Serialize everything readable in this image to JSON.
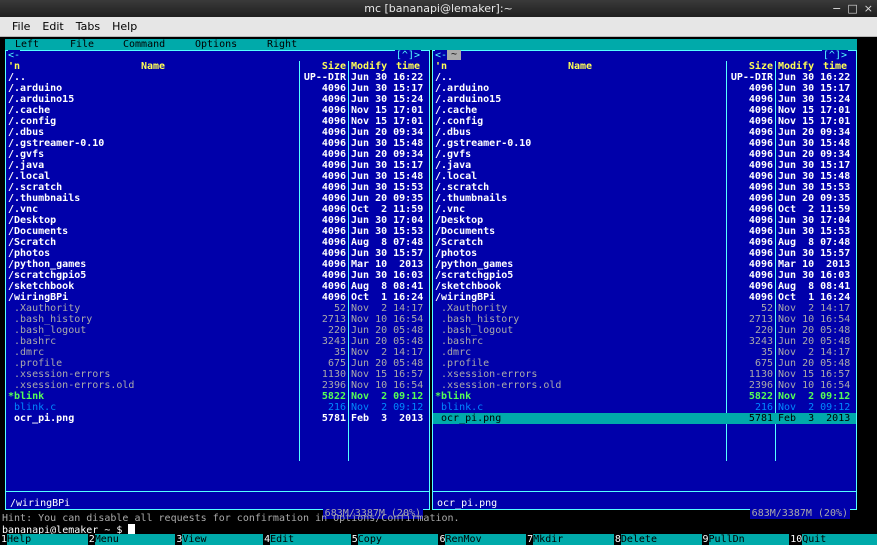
{
  "window": {
    "title": "mc [bananapi@lemaker]:~",
    "controls": [
      "−",
      "□",
      "×"
    ]
  },
  "menubar": [
    "File",
    "Edit",
    "Tabs",
    "Help"
  ],
  "mc_menu": [
    "Left",
    "File",
    "Command",
    "Options",
    "Right"
  ],
  "panels": {
    "header": {
      "sort": "'n",
      "name": "Name",
      "size": "Size",
      "modify": "Modify",
      "time": "time"
    },
    "left_corner": "<-",
    "left_indicator": "[^]>",
    "right_indicator": "[^]>",
    "right_tilde": "~",
    "left": {
      "mini_status": "/wiringBPi",
      "free_space": "683M/3387M (20%)",
      "files": [
        {
          "name": "/..",
          "size": "UP--DIR",
          "modify": "Jun 30 16:22",
          "type": "dir"
        },
        {
          "name": "/.arduino",
          "size": "4096",
          "modify": "Jun 30 15:17",
          "type": "dir"
        },
        {
          "name": "/.arduino15",
          "size": "4096",
          "modify": "Jun 30 15:24",
          "type": "dir"
        },
        {
          "name": "/.cache",
          "size": "4096",
          "modify": "Nov 15 17:01",
          "type": "dir"
        },
        {
          "name": "/.config",
          "size": "4096",
          "modify": "Nov 15 17:01",
          "type": "dir"
        },
        {
          "name": "/.dbus",
          "size": "4096",
          "modify": "Jun 20 09:34",
          "type": "dir"
        },
        {
          "name": "/.gstreamer-0.10",
          "size": "4096",
          "modify": "Jun 30 15:48",
          "type": "dir"
        },
        {
          "name": "/.gvfs",
          "size": "4096",
          "modify": "Jun 20 09:34",
          "type": "dir"
        },
        {
          "name": "/.java",
          "size": "4096",
          "modify": "Jun 30 15:17",
          "type": "dir"
        },
        {
          "name": "/.local",
          "size": "4096",
          "modify": "Jun 30 15:48",
          "type": "dir"
        },
        {
          "name": "/.scratch",
          "size": "4096",
          "modify": "Jun 30 15:53",
          "type": "dir"
        },
        {
          "name": "/.thumbnails",
          "size": "4096",
          "modify": "Jun 20 09:35",
          "type": "dir"
        },
        {
          "name": "/.vnc",
          "size": "4096",
          "modify": "Oct  2 11:59",
          "type": "dir"
        },
        {
          "name": "/Desktop",
          "size": "4096",
          "modify": "Jun 30 17:04",
          "type": "dir"
        },
        {
          "name": "/Documents",
          "size": "4096",
          "modify": "Jun 30 15:53",
          "type": "dir"
        },
        {
          "name": "/Scratch",
          "size": "4096",
          "modify": "Aug  8 07:48",
          "type": "dir"
        },
        {
          "name": "/photos",
          "size": "4096",
          "modify": "Jun 30 15:57",
          "type": "dir"
        },
        {
          "name": "/python_games",
          "size": "4096",
          "modify": "Mar 10  2013",
          "type": "dir"
        },
        {
          "name": "/scratchgpio5",
          "size": "4096",
          "modify": "Jun 30 16:03",
          "type": "dir"
        },
        {
          "name": "/sketchbook",
          "size": "4096",
          "modify": "Aug  8 08:41",
          "type": "dir"
        },
        {
          "name": "/wiringBPi",
          "size": "4096",
          "modify": "Oct  1 16:24",
          "type": "dir"
        },
        {
          "name": " .Xauthority",
          "size": "52",
          "modify": "Nov  2 14:17",
          "type": "file"
        },
        {
          "name": " .bash_history",
          "size": "2713",
          "modify": "Nov 10 16:54",
          "type": "file"
        },
        {
          "name": " .bash_logout",
          "size": "220",
          "modify": "Jun 20 05:48",
          "type": "file"
        },
        {
          "name": " .bashrc",
          "size": "3243",
          "modify": "Jun 20 05:48",
          "type": "file"
        },
        {
          "name": " .dmrc",
          "size": "35",
          "modify": "Nov  2 14:17",
          "type": "file"
        },
        {
          "name": " .profile",
          "size": "675",
          "modify": "Jun 20 05:48",
          "type": "file"
        },
        {
          "name": " .xsession-errors",
          "size": "1130",
          "modify": "Nov 15 16:57",
          "type": "file"
        },
        {
          "name": " .xsession-errors.old",
          "size": "2396",
          "modify": "Nov 10 16:54",
          "type": "file"
        },
        {
          "name": "*blink",
          "size": "5822",
          "modify": "Nov  2 09:12",
          "type": "exec"
        },
        {
          "name": " blink.c",
          "size": "216",
          "modify": "Nov  2 09:12",
          "type": "csrc"
        },
        {
          "name": " ocr_pi.png",
          "size": "5781",
          "modify": "Feb  3  2013",
          "type": "img"
        }
      ]
    },
    "right": {
      "mini_status": "ocr_pi.png",
      "free_space": "683M/3387M (20%)",
      "selected_index": 31,
      "files": [
        {
          "name": "/..",
          "size": "UP--DIR",
          "modify": "Jun 30 16:22",
          "type": "dir"
        },
        {
          "name": "/.arduino",
          "size": "4096",
          "modify": "Jun 30 15:17",
          "type": "dir"
        },
        {
          "name": "/.arduino15",
          "size": "4096",
          "modify": "Jun 30 15:24",
          "type": "dir"
        },
        {
          "name": "/.cache",
          "size": "4096",
          "modify": "Nov 15 17:01",
          "type": "dir"
        },
        {
          "name": "/.config",
          "size": "4096",
          "modify": "Nov 15 17:01",
          "type": "dir"
        },
        {
          "name": "/.dbus",
          "size": "4096",
          "modify": "Jun 20 09:34",
          "type": "dir"
        },
        {
          "name": "/.gstreamer-0.10",
          "size": "4096",
          "modify": "Jun 30 15:48",
          "type": "dir"
        },
        {
          "name": "/.gvfs",
          "size": "4096",
          "modify": "Jun 20 09:34",
          "type": "dir"
        },
        {
          "name": "/.java",
          "size": "4096",
          "modify": "Jun 30 15:17",
          "type": "dir"
        },
        {
          "name": "/.local",
          "size": "4096",
          "modify": "Jun 30 15:48",
          "type": "dir"
        },
        {
          "name": "/.scratch",
          "size": "4096",
          "modify": "Jun 30 15:53",
          "type": "dir"
        },
        {
          "name": "/.thumbnails",
          "size": "4096",
          "modify": "Jun 20 09:35",
          "type": "dir"
        },
        {
          "name": "/.vnc",
          "size": "4096",
          "modify": "Oct  2 11:59",
          "type": "dir"
        },
        {
          "name": "/Desktop",
          "size": "4096",
          "modify": "Jun 30 17:04",
          "type": "dir"
        },
        {
          "name": "/Documents",
          "size": "4096",
          "modify": "Jun 30 15:53",
          "type": "dir"
        },
        {
          "name": "/Scratch",
          "size": "4096",
          "modify": "Aug  8 07:48",
          "type": "dir"
        },
        {
          "name": "/photos",
          "size": "4096",
          "modify": "Jun 30 15:57",
          "type": "dir"
        },
        {
          "name": "/python_games",
          "size": "4096",
          "modify": "Mar 10  2013",
          "type": "dir"
        },
        {
          "name": "/scratchgpio5",
          "size": "4096",
          "modify": "Jun 30 16:03",
          "type": "dir"
        },
        {
          "name": "/sketchbook",
          "size": "4096",
          "modify": "Aug  8 08:41",
          "type": "dir"
        },
        {
          "name": "/wiringBPi",
          "size": "4096",
          "modify": "Oct  1 16:24",
          "type": "dir"
        },
        {
          "name": " .Xauthority",
          "size": "52",
          "modify": "Nov  2 14:17",
          "type": "file"
        },
        {
          "name": " .bash_history",
          "size": "2713",
          "modify": "Nov 10 16:54",
          "type": "file"
        },
        {
          "name": " .bash_logout",
          "size": "220",
          "modify": "Jun 20 05:48",
          "type": "file"
        },
        {
          "name": " .bashrc",
          "size": "3243",
          "modify": "Jun 20 05:48",
          "type": "file"
        },
        {
          "name": " .dmrc",
          "size": "35",
          "modify": "Nov  2 14:17",
          "type": "file"
        },
        {
          "name": " .profile",
          "size": "675",
          "modify": "Jun 20 05:48",
          "type": "file"
        },
        {
          "name": " .xsession-errors",
          "size": "1130",
          "modify": "Nov 15 16:57",
          "type": "file"
        },
        {
          "name": " .xsession-errors.old",
          "size": "2396",
          "modify": "Nov 10 16:54",
          "type": "file"
        },
        {
          "name": "*blink",
          "size": "5822",
          "modify": "Nov  2 09:12",
          "type": "exec"
        },
        {
          "name": " blink.c",
          "size": "216",
          "modify": "Nov  2 09:12",
          "type": "csrc"
        },
        {
          "name": " ocr_pi.png",
          "size": "5781",
          "modify": "Feb  3  2013",
          "type": "img"
        }
      ]
    }
  },
  "hint": "Hint: You can disable all requests for confirmation in Options/Confirmation.",
  "prompt": "bananapi@lemaker ~ $ ",
  "fkeys": [
    {
      "num": "1",
      "label": "Help"
    },
    {
      "num": "2",
      "label": "Menu"
    },
    {
      "num": "3",
      "label": "View"
    },
    {
      "num": "4",
      "label": "Edit"
    },
    {
      "num": "5",
      "label": "Copy"
    },
    {
      "num": "6",
      "label": "RenMov"
    },
    {
      "num": "7",
      "label": "Mkdir"
    },
    {
      "num": "8",
      "label": "Delete"
    },
    {
      "num": "9",
      "label": "PullDn"
    },
    {
      "num": "10",
      "label": "Quit"
    }
  ]
}
